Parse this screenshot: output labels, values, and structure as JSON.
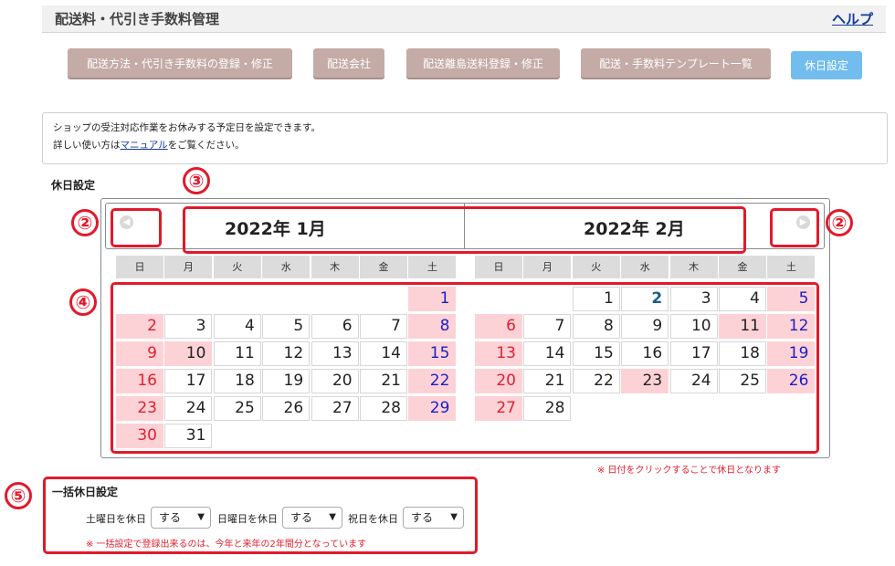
{
  "header": {
    "title": "配送料・代引き手数料管理",
    "help": "ヘルプ"
  },
  "tabs": [
    {
      "label": "配送方法・代引き手数料の登録・修正",
      "active": false
    },
    {
      "label": "配送会社",
      "active": false
    },
    {
      "label": "配送離島送料登録・修正",
      "active": false
    },
    {
      "label": "配送・手数料テンプレート一覧",
      "active": false
    },
    {
      "label": "休日設定",
      "active": true
    }
  ],
  "info": {
    "line1": "ショップの受注対応作業をお休みする予定日を設定できます。",
    "line2_prefix": "詳しい使い方は",
    "line2_link": "マニュアル",
    "line2_suffix": "をご覧ください。"
  },
  "holiday_section": {
    "title": "休日設定"
  },
  "calendar": {
    "weekdays": [
      "日",
      "月",
      "火",
      "水",
      "木",
      "金",
      "土"
    ],
    "months": [
      {
        "label": "2022年 1月",
        "days": [
          "",
          "",
          "",
          "",
          "",
          "",
          "1",
          "2",
          "3",
          "4",
          "5",
          "6",
          "7",
          "8",
          "9",
          "10",
          "11",
          "12",
          "13",
          "14",
          "15",
          "16",
          "17",
          "18",
          "19",
          "20",
          "21",
          "22",
          "23",
          "24",
          "25",
          "26",
          "27",
          "28",
          "29",
          "30",
          "31",
          "",
          "",
          "",
          "",
          ""
        ]
      },
      {
        "label": "2022年 2月",
        "days": [
          "",
          "",
          "1",
          "2",
          "3",
          "4",
          "5",
          "6",
          "7",
          "8",
          "9",
          "10",
          "11",
          "12",
          "13",
          "14",
          "15",
          "16",
          "17",
          "18",
          "19",
          "20",
          "21",
          "22",
          "23",
          "24",
          "25",
          "26",
          "27",
          "28",
          "",
          "",
          "",
          "",
          "",
          "",
          "",
          "",
          "",
          "",
          "",
          ""
        ]
      }
    ],
    "holiday_days": {
      "0": [
        "10"
      ],
      "1": [
        "11",
        "23"
      ]
    },
    "today": {
      "month": 1,
      "day": "2"
    },
    "note": "※ 日付をクリックすることで休日となります",
    "prev_icon": "chevron-left-icon",
    "next_icon": "chevron-right-icon"
  },
  "markers": {
    "m2a": "②",
    "m2b": "②",
    "m3": "③",
    "m4": "④",
    "m5": "⑤"
  },
  "bulk": {
    "title": "一括休日設定",
    "saturday_label": "土曜日を休日",
    "saturday_value": "する",
    "sunday_label": "日曜日を休日",
    "sunday_value": "する",
    "holiday_label": "祝日を休日",
    "holiday_value": "する",
    "note": "※ 一括設定で登録出来るのは、今年と来年の2年間分となっています"
  },
  "colors": {
    "holiday_bg": "#fcd2d6",
    "sunday": "#e02030",
    "saturday": "#1d1dc8",
    "annotation": "#e2192b",
    "active_tab": "#73bdee",
    "tab": "#c4aba6"
  }
}
